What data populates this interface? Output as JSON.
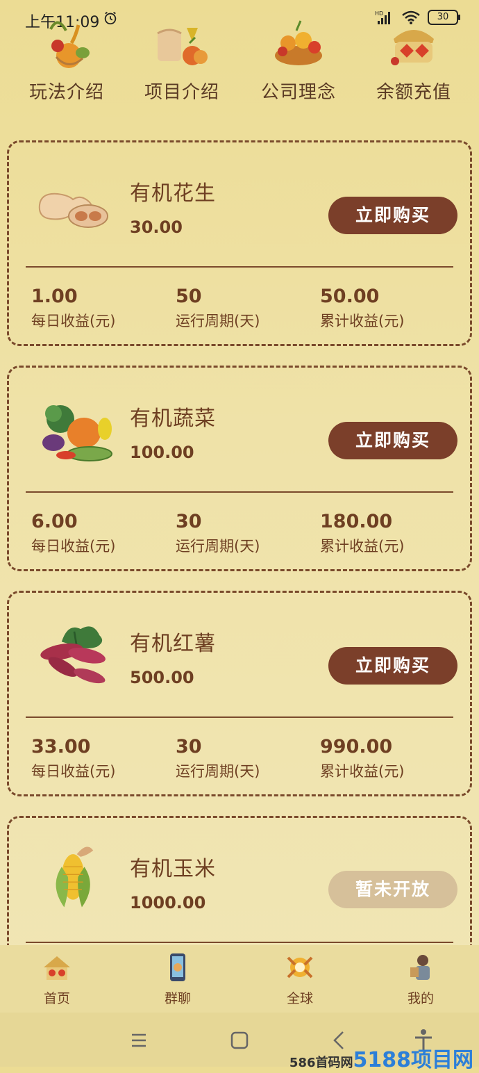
{
  "status": {
    "time": "上午11:09",
    "battery": "30"
  },
  "top_menu": [
    {
      "label": "玩法介绍",
      "icon": "harvest-basket-icon"
    },
    {
      "label": "项目介绍",
      "icon": "grain-sack-icon"
    },
    {
      "label": "公司理念",
      "icon": "fruit-basket-icon"
    },
    {
      "label": "余额充值",
      "icon": "money-bag-icon"
    }
  ],
  "products": [
    {
      "name": "有机花生",
      "price": "30.00",
      "button": "立即购买",
      "icon": "peanut-icon",
      "daily": "1.00",
      "daily_label": "每日收益(元)",
      "period": "50",
      "period_label": "运行周期(天)",
      "total": "50.00",
      "total_label": "累计收益(元)"
    },
    {
      "name": "有机蔬菜",
      "price": "100.00",
      "button": "立即购买",
      "icon": "vegetables-icon",
      "daily": "6.00",
      "daily_label": "每日收益(元)",
      "period": "30",
      "period_label": "运行周期(天)",
      "total": "180.00",
      "total_label": "累计收益(元)"
    },
    {
      "name": "有机红薯",
      "price": "500.00",
      "button": "立即购买",
      "icon": "sweet-potato-icon",
      "daily": "33.00",
      "daily_label": "每日收益(元)",
      "period": "30",
      "period_label": "运行周期(天)",
      "total": "990.00",
      "total_label": "累计收益(元)"
    },
    {
      "name": "有机玉米",
      "price": "1000.00",
      "button": "暂未开放",
      "icon": "corn-icon"
    }
  ],
  "bottom_nav": [
    {
      "label": "首页",
      "icon": "home-icon"
    },
    {
      "label": "群聊",
      "icon": "group-chat-icon"
    },
    {
      "label": "全球",
      "icon": "global-icon"
    },
    {
      "label": "我的",
      "icon": "profile-icon"
    }
  ],
  "watermark": {
    "prefix": "586首码网",
    "big": "5188项目网"
  },
  "colors": {
    "accent": "#7b3f2a",
    "disabled": "#d6c09a",
    "text": "#6e3f22",
    "background": "#efe2a8"
  }
}
